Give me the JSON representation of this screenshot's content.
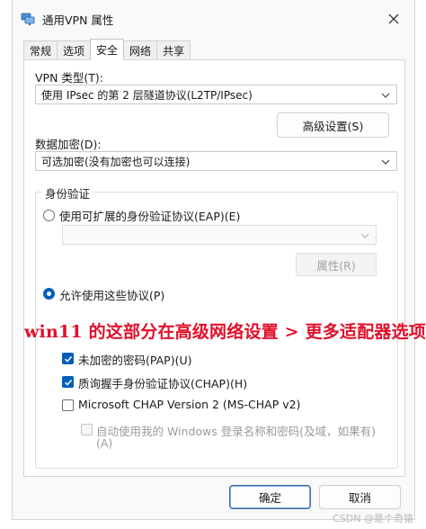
{
  "window": {
    "title": "通用VPN 属性"
  },
  "tabs": [
    {
      "label": "常规"
    },
    {
      "label": "选项"
    },
    {
      "label": "安全"
    },
    {
      "label": "网络"
    },
    {
      "label": "共享"
    }
  ],
  "security": {
    "vpn_type_label": "VPN 类型(T):",
    "vpn_type_value": "使用 IPsec 的第 2 层隧道协议(L2TP/IPsec)",
    "advanced_settings_button": "高级设置(S)",
    "encryption_label": "数据加密(D):",
    "encryption_value": "可选加密(没有加密也可以连接)",
    "auth_group_title": "身份验证",
    "eap_radio_label": "使用可扩展的身份验证协议(EAP)(E)",
    "eap_combo_value": "",
    "properties_button": "属性(R)",
    "allow_protocols_label": "允许使用这些协议(P)",
    "pap_label": "未加密的密码(PAP)(U)",
    "chap_label": "质询握手身份验证协议(CHAP)(H)",
    "mschap_label": "Microsoft CHAP Version 2 (MS-CHAP v2)",
    "auto_login_label_line1": "自动使用我的 Windows 登录名称和密码(及域，如果有)",
    "auto_login_label_line2": "(A)"
  },
  "annotation": {
    "text": "win11 的这部分在高级网络设置 > 更多适配器选项"
  },
  "footer": {
    "ok_button": "确定",
    "cancel_button": "取消"
  },
  "watermark": {
    "text": "CSDN @是个奇猿"
  },
  "state": {
    "active_tab": "安全",
    "eap_selected": false,
    "allow_protocols_selected": true,
    "pap_checked": true,
    "chap_checked": true,
    "mschap_checked": false,
    "auto_login_checked": false,
    "auto_login_enabled": false
  },
  "colors": {
    "accent": "#005fb8",
    "annotation": "#e0102a"
  }
}
